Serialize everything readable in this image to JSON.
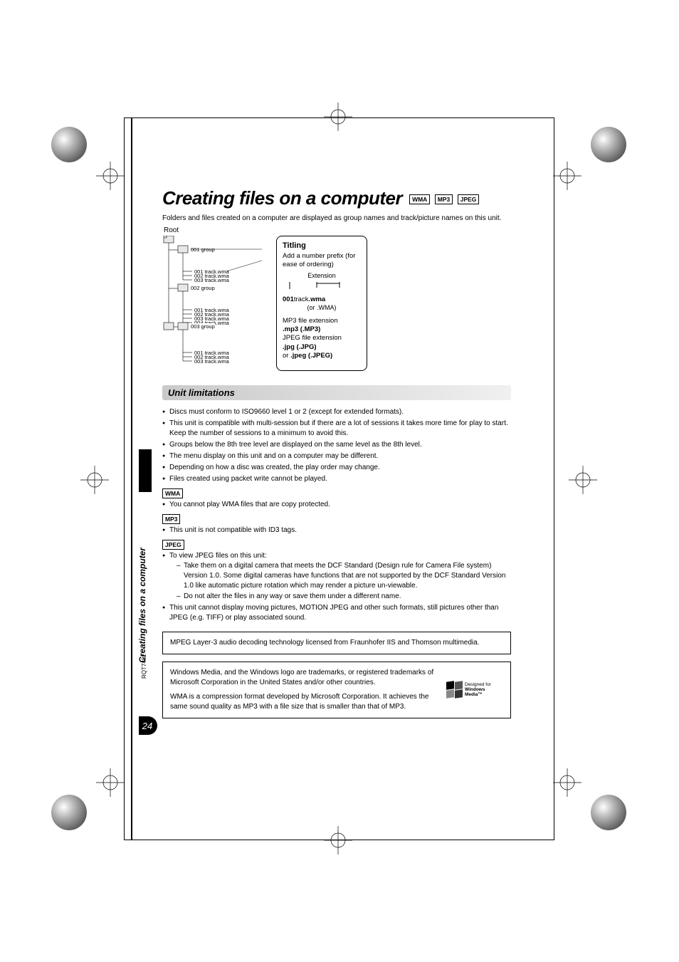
{
  "header": {
    "title": "Creating files on a computer",
    "tags": [
      "WMA",
      "MP3",
      "JPEG"
    ]
  },
  "intro": "Folders and files created on a computer are displayed as group names and track/picture names on this unit.",
  "root_label": "Root",
  "tree": {
    "g1": "001 group",
    "g1_files": [
      "001 track.wma",
      "002 track.wma",
      "003 track.wma"
    ],
    "g2": "002 group",
    "g2_files": [
      "001 track.wma",
      "002 track.wma",
      "003 track.wma",
      "004 track.wma"
    ],
    "g3": "003 group",
    "g3_files": [
      "001 track.wma",
      "002 track.wma",
      "003 track.wma"
    ]
  },
  "titling": {
    "heading": "Titling",
    "line1": "Add a number prefix (for ease of ordering)",
    "ext_label": "Extension",
    "fn_prefix": "001",
    "fn_mid": "track",
    "fn_ext": ".wma",
    "fn_alt": "(or .WMA)",
    "mp3_label": "MP3 file extension",
    "mp3_ext": ".mp3 (.MP3)",
    "jpeg_label": "JPEG file extension",
    "jpg_ext": ".jpg (.JPG)",
    "or": "or ",
    "jpeg_ext": ".jpeg (.JPEG)"
  },
  "section_hdr": "Unit limitations",
  "limits_general": [
    "Discs must conform to ISO9660 level 1 or 2 (except for extended formats).",
    "This unit is compatible with multi-session but if there are a lot of sessions it takes more time for play to start. Keep the number of sessions to a minimum to avoid this.",
    "Groups below the 8th tree level are displayed on the same level as the 8th level.",
    "The menu display on this unit and on a computer may be different.",
    "Depending on how a disc was created, the play order may change.",
    "Files created using packet write cannot be played."
  ],
  "wma_tag": "WMA",
  "limits_wma": [
    "You cannot play WMA files that are copy protected."
  ],
  "mp3_tag": "MP3",
  "limits_mp3": [
    "This unit is not compatible with ID3 tags."
  ],
  "jpeg_tag": "JPEG",
  "limits_jpeg_intro": "To view JPEG files on this unit:",
  "limits_jpeg_sub": [
    "Take them on a digital camera that meets the DCF Standard (Design rule for Camera File system) Version 1.0. Some digital cameras have functions that are not supported by the DCF Standard Version 1.0 like automatic picture rotation which may render a picture un-viewable.",
    "Do not alter the files in any way or save them under a different name."
  ],
  "limits_jpeg_after": "This unit cannot display moving pictures, MOTION JPEG and other such formats, still pictures other than JPEG (e.g. TIFF) or play associated sound.",
  "notice_mpeg": "MPEG Layer-3 audio decoding technology licensed from Fraunhofer IIS and Thomson multimedia.",
  "notice_wm1": "Windows Media, and the Windows logo are trademarks, or registered trademarks of Microsoft Corporation in the United States and/or other countries.",
  "notice_wm2": "WMA is a compression format developed by Microsoft Corporation. It achieves the same sound quality as MP3 with a file size that is smaller than that of MP3.",
  "wm_logo": {
    "l1": "Designed for",
    "l2": "Windows",
    "l3": "Media™"
  },
  "sidetab": "Creating files on a computer",
  "docid": "RQT7482",
  "pagenum": "24"
}
